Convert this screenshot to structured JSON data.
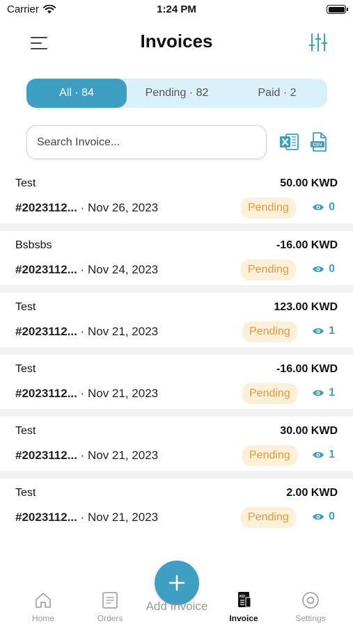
{
  "status_bar": {
    "carrier": "Carrier",
    "time": "1:24 PM"
  },
  "header": {
    "title": "Invoices"
  },
  "tabs": [
    {
      "label": "All · 84",
      "active": true
    },
    {
      "label": "Pending · 82",
      "active": false
    },
    {
      "label": "Paid · 2",
      "active": false
    }
  ],
  "search": {
    "placeholder": "Search Invoice...",
    "value": ""
  },
  "export": {
    "csv_label": "CSV"
  },
  "invoices": [
    {
      "name": "Test",
      "amount": "50.00 KWD",
      "number": "#2023112...",
      "date": " · Nov 26, 2023",
      "status": "Pending",
      "views": "0"
    },
    {
      "name": "Bsbsbs",
      "amount": "-16.00 KWD",
      "number": "#2023112...",
      "date": " · Nov 24, 2023",
      "status": "Pending",
      "views": "0"
    },
    {
      "name": "Test",
      "amount": "123.00 KWD",
      "number": "#2023112...",
      "date": " · Nov 21, 2023",
      "status": "Pending",
      "views": "1"
    },
    {
      "name": "Test",
      "amount": "-16.00 KWD",
      "number": "#2023112...",
      "date": " · Nov 21, 2023",
      "status": "Pending",
      "views": "1"
    },
    {
      "name": "Test",
      "amount": "30.00 KWD",
      "number": "#2023112...",
      "date": " · Nov 21, 2023",
      "status": "Pending",
      "views": "1"
    },
    {
      "name": "Test",
      "amount": "2.00 KWD",
      "number": "#2023112...",
      "date": " · Nov 21, 2023",
      "status": "Pending",
      "views": "0"
    }
  ],
  "bottom_nav": {
    "home": "Home",
    "orders": "Orders",
    "add_invoice": "Add Invoice",
    "invoice": "Invoice",
    "invoice_icon_text": "KD",
    "settings": "Settings",
    "active": "invoice"
  },
  "colors": {
    "accent": "#3f9fc2",
    "tab_bg": "#d8f1fb",
    "pending_bg": "#fdf0d9",
    "pending_text": "#e59a3d"
  }
}
